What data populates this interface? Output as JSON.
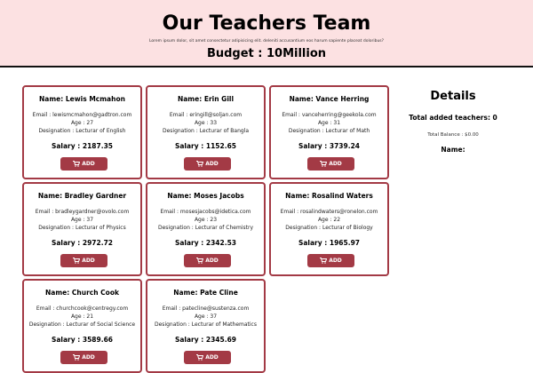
{
  "header": {
    "title": "Our Teachers Team",
    "lorem": "Lorem ipsum dolor, sit amet consectetur adipisicing elit. deleniti accusantium eos harum sapiente placeat doloribus?",
    "budget": "Budget : 10Million"
  },
  "teachers": [
    {
      "name": "Name: Lewis Mcmahon",
      "email": "Email : lewismcmahon@gadtron.com",
      "age": "Age : 27",
      "designation": "Designation : Lecturar of English",
      "salary": "Salary : 2187.35",
      "add": "ADD"
    },
    {
      "name": "Name: Erin Gill",
      "email": "Email : eringill@soljan.com",
      "age": "Age : 33",
      "designation": "Designation : Lecturar of Bangla",
      "salary": "Salary : 1152.65",
      "add": "ADD"
    },
    {
      "name": "Name: Vance Herring",
      "email": "Email : vanceherring@geekola.com",
      "age": "Age : 31",
      "designation": "Designation : Lecturar of Math",
      "salary": "Salary : 3739.24",
      "add": "ADD"
    },
    {
      "name": "Name: Bradley Gardner",
      "email": "Email : bradleygardner@ovolo.com",
      "age": "Age : 37",
      "designation": "Designation : Lecturar of Physics",
      "salary": "Salary : 2972.72",
      "add": "ADD"
    },
    {
      "name": "Name: Moses Jacobs",
      "email": "Email : mosesjacobs@idetica.com",
      "age": "Age : 23",
      "designation": "Designation : Lecturar of Chemistry",
      "salary": "Salary : 2342.53",
      "add": "ADD"
    },
    {
      "name": "Name: Rosalind Waters",
      "email": "Email : rosalindwaters@ronelon.com",
      "age": "Age : 22",
      "designation": "Designation : Lecturar of Biology",
      "salary": "Salary : 1965.97",
      "add": "ADD"
    },
    {
      "name": "Name: Church Cook",
      "email": "Email : churchcook@centregy.com",
      "age": "Age : 21",
      "designation": "Designation : Lecturar of Social Science",
      "salary": "Salary : 3589.66",
      "add": "ADD"
    },
    {
      "name": "Name: Pate Cline",
      "email": "Email : patecline@sustenza.com",
      "age": "Age : 37",
      "designation": "Designation : Lecturar of Mathematics",
      "salary": "Salary : 2345.69",
      "add": "ADD"
    }
  ],
  "details": {
    "title": "Details",
    "total_added": "Total added teachers: 0",
    "balance": "Total Balance : $0.00",
    "name_label": "Name:"
  },
  "colors": {
    "header_bg": "#fce1e2",
    "accent": "#a33a45"
  },
  "icons": {
    "add_button": "cart-icon"
  }
}
